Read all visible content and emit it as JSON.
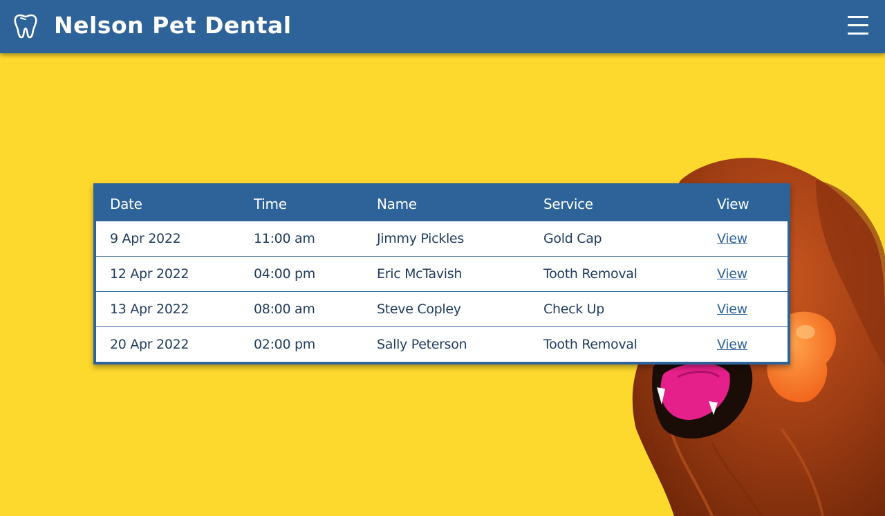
{
  "header": {
    "brand": "Nelson Pet Dental",
    "logo_icon": "tooth-icon",
    "menu_icon": "hamburger-menu-icon"
  },
  "colors": {
    "background": "#FED92D",
    "primary": "#2E6399",
    "text": "#1E3A5F"
  },
  "table": {
    "columns": [
      "Date",
      "Time",
      "Name",
      "Service",
      "View"
    ],
    "rows": [
      {
        "date": "9 Apr 2022",
        "time": "11:00 am",
        "name": "Jimmy Pickles",
        "service": "Gold Cap",
        "view": "View"
      },
      {
        "date": "12 Apr 2022",
        "time": "04:00 pm",
        "name": "Eric McTavish",
        "service": "Tooth Removal",
        "view": "View"
      },
      {
        "date": "13 Apr 2022",
        "time": "08:00 am",
        "name": "Steve Copley",
        "service": "Check Up",
        "view": "View"
      },
      {
        "date": "20 Apr 2022",
        "time": "02:00 pm",
        "name": "Sally Peterson",
        "service": "Tooth Removal",
        "view": "View"
      }
    ]
  },
  "hero_image": "dog-with-toy-image"
}
